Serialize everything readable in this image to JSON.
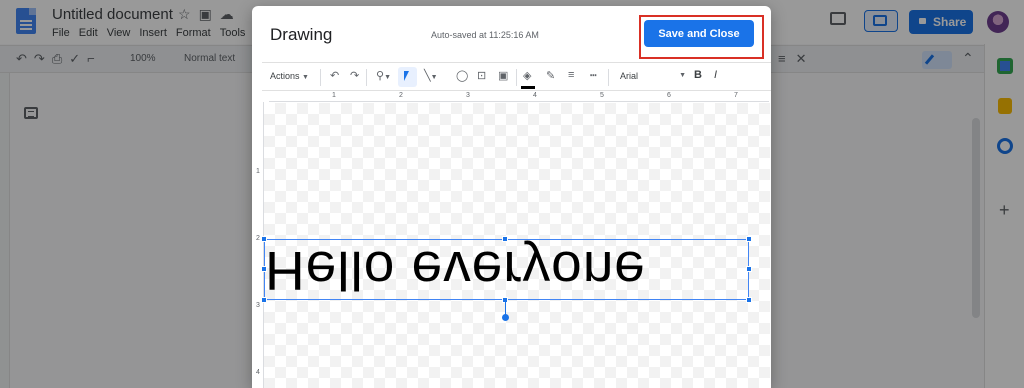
{
  "docs": {
    "title": "Untitled document",
    "menu": [
      "File",
      "Edit",
      "View",
      "Insert",
      "Format",
      "Tools"
    ],
    "share_label": "Share",
    "zoom": "100%",
    "paragraph_style": "Normal text"
  },
  "dialog": {
    "title": "Drawing",
    "autosave": "Auto-saved at 11:25:16 AM",
    "save_label": "Save and Close",
    "actions_label": "Actions",
    "font": "Arial",
    "bold_label": "B",
    "italic_label": "I"
  },
  "rulers": {
    "horizontal": [
      "1",
      "2",
      "3",
      "4",
      "5",
      "6",
      "7"
    ],
    "vertical": [
      "1",
      "2",
      "3",
      "4"
    ]
  },
  "canvas": {
    "text": "Hello everyone",
    "transform": "flipped-vertical"
  },
  "colors": {
    "accent": "#1a73e8",
    "highlight": "#d93025"
  }
}
